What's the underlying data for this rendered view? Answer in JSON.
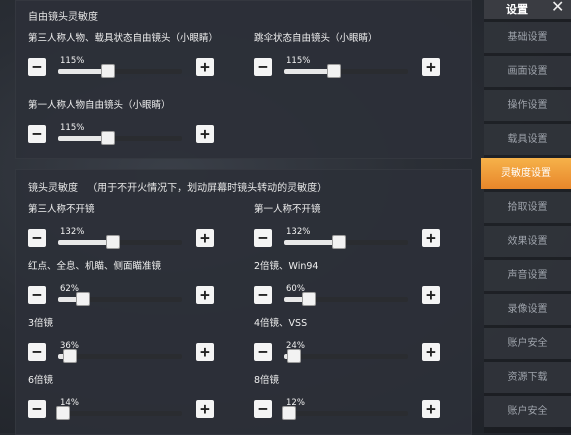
{
  "free_camera": {
    "title": "自由镜头灵敏度",
    "sliders": [
      {
        "label": "第三人称人物、载具状态自由镜头（小眼睛）",
        "value_text": "115%",
        "fraction": 0.4
      },
      {
        "label": "跳伞状态自由镜头（小眼睛）",
        "value_text": "115%",
        "fraction": 0.4
      },
      {
        "label": "第一人称人物自由镜头（小眼睛）",
        "value_text": "115%",
        "fraction": 0.4
      }
    ]
  },
  "lens": {
    "title": "镜头灵敏度",
    "subtitle": "（用于不开火情况下，划动屏幕时镜头转动的灵敏度）",
    "sliders": [
      {
        "label": "第三人称不开镜",
        "value_text": "132%",
        "fraction": 0.44
      },
      {
        "label": "第一人称不开镜",
        "value_text": "132%",
        "fraction": 0.44
      },
      {
        "label": "红点、全息、机瞄、侧面瞄准镜",
        "value_text": "62%",
        "fraction": 0.2
      },
      {
        "label": "2倍镜、Win94",
        "value_text": "60%",
        "fraction": 0.2
      },
      {
        "label": "3倍镜",
        "value_text": "36%",
        "fraction": 0.1
      },
      {
        "label": "4倍镜、VSS",
        "value_text": "24%",
        "fraction": 0.08
      },
      {
        "label": "6倍镜",
        "value_text": "14%",
        "fraction": 0.04
      },
      {
        "label": "8倍镜",
        "value_text": "12%",
        "fraction": 0.04
      }
    ]
  },
  "buttons": {
    "minus": "−",
    "plus": "+"
  },
  "sidebar": {
    "title": "设置",
    "close": "✕",
    "items": [
      {
        "label": "基础设置",
        "active": false
      },
      {
        "label": "画面设置",
        "active": false
      },
      {
        "label": "操作设置",
        "active": false
      },
      {
        "label": "载具设置",
        "active": false
      },
      {
        "label": "灵敏度设置",
        "active": true
      },
      {
        "label": "拾取设置",
        "active": false
      },
      {
        "label": "效果设置",
        "active": false
      },
      {
        "label": "声音设置",
        "active": false
      },
      {
        "label": "录像设置",
        "active": false
      },
      {
        "label": "账户安全",
        "active": false
      },
      {
        "label": "资源下载",
        "active": false
      },
      {
        "label": "账户安全",
        "active": false
      }
    ]
  }
}
